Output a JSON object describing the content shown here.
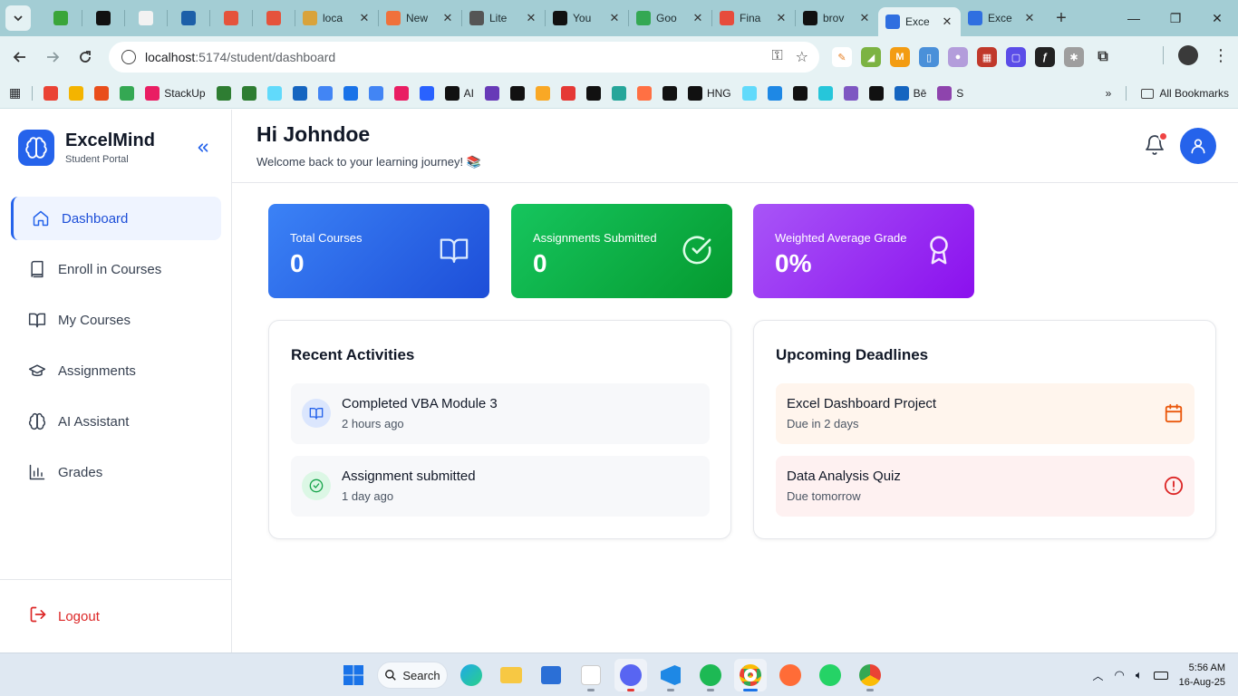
{
  "browser": {
    "tabs": [
      {
        "label": "",
        "kind": "small",
        "color": "#3aa53a"
      },
      {
        "label": "",
        "kind": "small",
        "color": "#111111"
      },
      {
        "label": "",
        "kind": "small",
        "color": "#f2f2f2"
      },
      {
        "label": "",
        "kind": "small",
        "color": "#1d5fa8"
      },
      {
        "label": "",
        "kind": "small",
        "color": "#e5533c"
      },
      {
        "label": "",
        "kind": "small",
        "color": "#e5533c"
      },
      {
        "label": "loca",
        "kind": "wide",
        "color": "#d9a33b"
      },
      {
        "label": "New",
        "kind": "wide",
        "color": "#f0713b"
      },
      {
        "label": "Lite",
        "kind": "wide",
        "color": "#555555"
      },
      {
        "label": "You",
        "kind": "wide",
        "color": "#111111"
      },
      {
        "label": "Goo",
        "kind": "wide",
        "color": "#34a853"
      },
      {
        "label": "Fina",
        "kind": "wide",
        "color": "#e74c3c"
      },
      {
        "label": "brov",
        "kind": "wide",
        "color": "#111111"
      },
      {
        "label": "Exce",
        "kind": "active",
        "color": "#2f6fe0"
      },
      {
        "label": "Exce",
        "kind": "wide",
        "color": "#2f6fe0"
      }
    ],
    "url_host": "localhost",
    "url_path": ":5174/student/dashboard",
    "bookmarks": [
      {
        "label": "",
        "color": "#ea4335"
      },
      {
        "label": "",
        "color": "#f4b400"
      },
      {
        "label": "",
        "color": "#e94e1b"
      },
      {
        "label": "",
        "color": "#34a853"
      },
      {
        "label": "StackUp",
        "color": "#e91e63"
      },
      {
        "label": "",
        "color": "#2e7d32"
      },
      {
        "label": "",
        "color": "#2e7d32"
      },
      {
        "label": "",
        "color": "#61dafb"
      },
      {
        "label": "",
        "color": "#1565c0"
      },
      {
        "label": "",
        "color": "#4285f4"
      },
      {
        "label": "",
        "color": "#1a73e8"
      },
      {
        "label": "",
        "color": "#4285f4"
      },
      {
        "label": "",
        "color": "#e91e63"
      },
      {
        "label": "",
        "color": "#2962ff"
      },
      {
        "label": "AI",
        "color": "#111111"
      },
      {
        "label": "",
        "color": "#673ab7"
      },
      {
        "label": "",
        "color": "#111111"
      },
      {
        "label": "",
        "color": "#f9a825"
      },
      {
        "label": "",
        "color": "#e53935"
      },
      {
        "label": "",
        "color": "#111111"
      },
      {
        "label": "",
        "color": "#26a69a"
      },
      {
        "label": "",
        "color": "#ff7043"
      },
      {
        "label": "",
        "color": "#111111"
      },
      {
        "label": "HNG",
        "color": "#111111"
      },
      {
        "label": "",
        "color": "#61dafb"
      },
      {
        "label": "",
        "color": "#1e88e5"
      },
      {
        "label": "",
        "color": "#111111"
      },
      {
        "label": "",
        "color": "#26c6da"
      },
      {
        "label": "",
        "color": "#7e57c2"
      },
      {
        "label": "",
        "color": "#111111"
      },
      {
        "label": "Bē",
        "color": "#1565c0"
      },
      {
        "label": "S",
        "color": "#8e44ad"
      }
    ],
    "all_bookmarks_label": "All Bookmarks"
  },
  "sidebar": {
    "brand_name": "ExcelMind",
    "brand_subtitle": "Student Portal",
    "items": [
      {
        "label": "Dashboard",
        "icon": "home-icon",
        "active": true
      },
      {
        "label": "Enroll in Courses",
        "icon": "book-icon",
        "active": false
      },
      {
        "label": "My Courses",
        "icon": "book-open-icon",
        "active": false
      },
      {
        "label": "Assignments",
        "icon": "graduation-cap-icon",
        "active": false
      },
      {
        "label": "AI Assistant",
        "icon": "brain-icon",
        "active": false
      },
      {
        "label": "Grades",
        "icon": "bar-chart-icon",
        "active": false
      }
    ],
    "logout_label": "Logout"
  },
  "header": {
    "greeting": "Hi Johndoe",
    "welcome": "Welcome back to your learning journey! 📚"
  },
  "stats": [
    {
      "label": "Total Courses",
      "value": "0",
      "icon": "book-open-icon"
    },
    {
      "label": "Assignments Submitted",
      "value": "0",
      "icon": "check-circle-icon"
    },
    {
      "label": "Weighted Average Grade",
      "value": "0%",
      "icon": "award-icon"
    }
  ],
  "recent_activities": {
    "title": "Recent Activities",
    "items": [
      {
        "title": "Completed VBA Module 3",
        "time": "2 hours ago",
        "icon": "book-open-icon",
        "color": "#2563eb"
      },
      {
        "title": "Assignment submitted",
        "time": "1 day ago",
        "icon": "check-circle-icon",
        "color": "#16a34a"
      }
    ]
  },
  "upcoming_deadlines": {
    "title": "Upcoming Deadlines",
    "items": [
      {
        "title": "Excel Dashboard Project",
        "due": "Due in 2 days",
        "icon": "calendar-icon",
        "color": "#ea580c"
      },
      {
        "title": "Data Analysis Quiz",
        "due": "Due tomorrow",
        "icon": "alert-circle-icon",
        "color": "#dc2626"
      }
    ]
  },
  "taskbar": {
    "search_label": "Search",
    "time": "5:56 AM",
    "date": "16-Aug-25"
  },
  "colors": {
    "primary": "#2563eb",
    "success": "#16a34a",
    "purple": "#9333ea",
    "danger": "#dc2626"
  }
}
